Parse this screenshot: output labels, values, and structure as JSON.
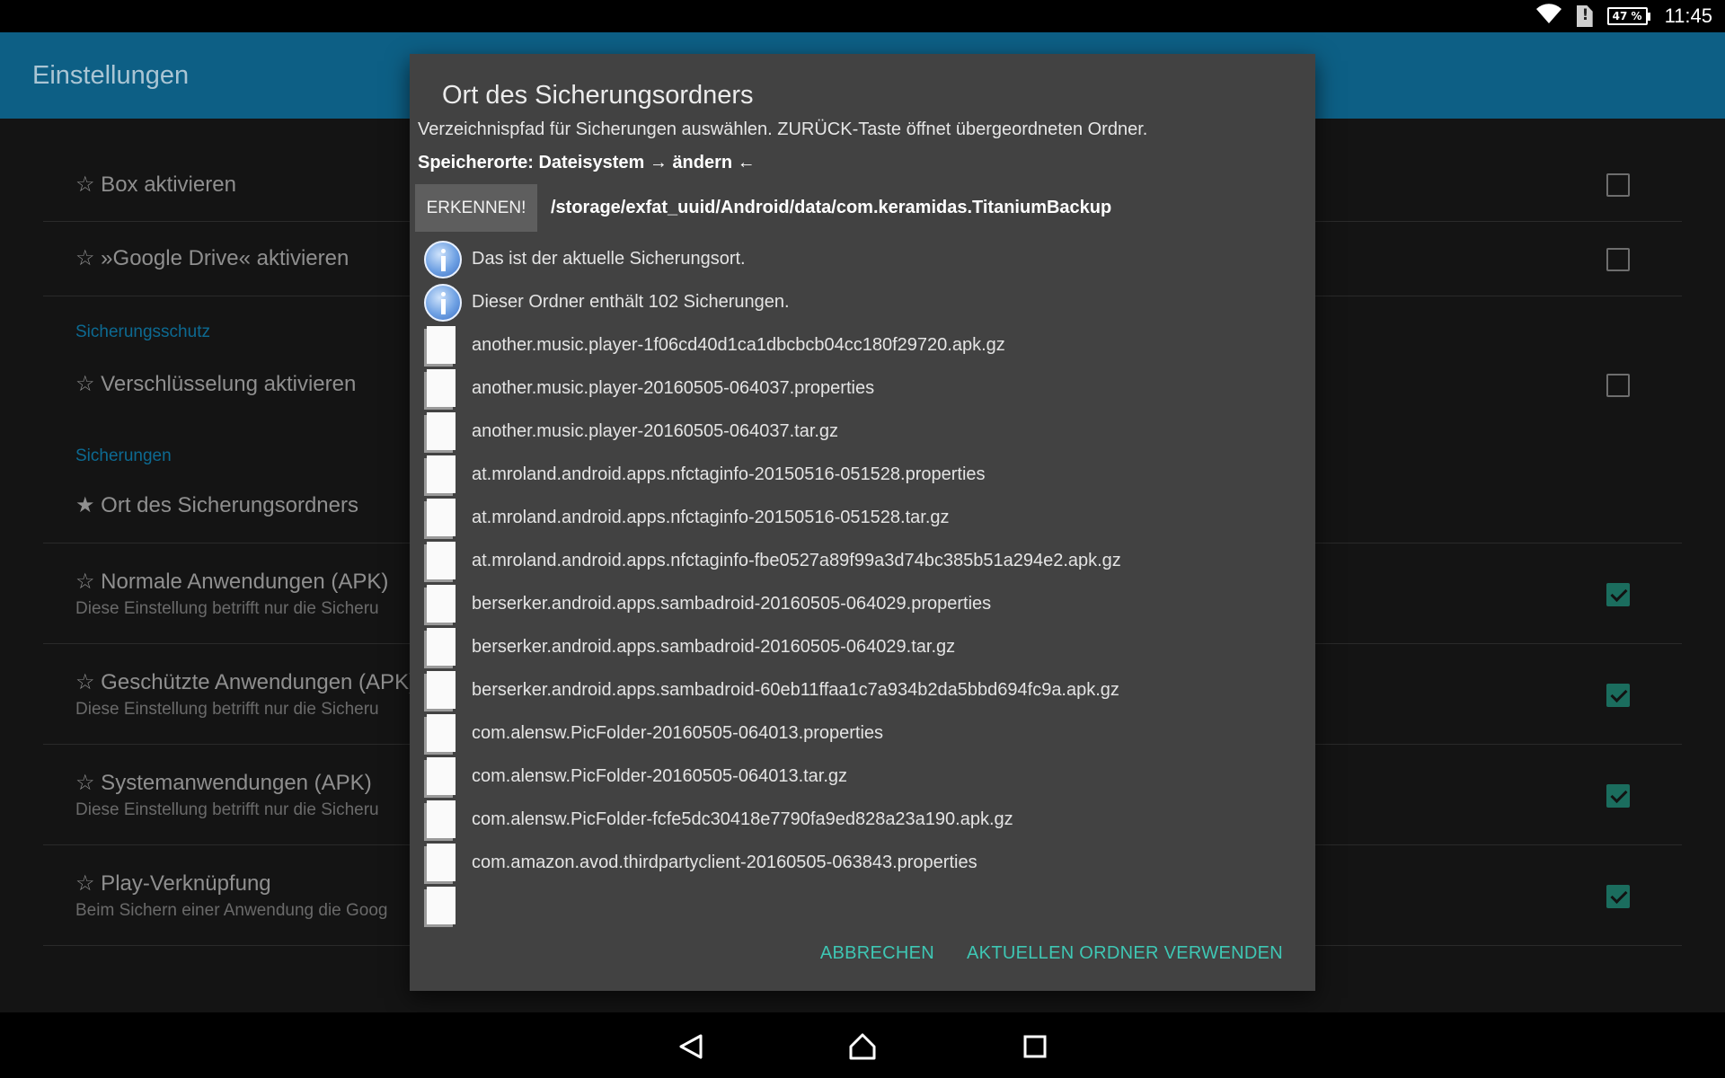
{
  "status_bar": {
    "battery": "47 %",
    "time": "11:45",
    "icons": [
      "wifi-icon",
      "sim-alert-icon",
      "battery-icon"
    ]
  },
  "app_bar": {
    "title": "Einstellungen"
  },
  "settings": {
    "items": [
      {
        "title": "☆ Box aktivieren",
        "checked": false
      },
      {
        "title": "☆ »Google Drive« aktivieren",
        "checked": false
      },
      {
        "title": "☆ Verschlüsselung aktivieren",
        "checked": false
      },
      {
        "title": "★ Ort des Sicherungsordners"
      },
      {
        "title": "☆ Normale Anwendungen (APK)",
        "subtitle": "Diese Einstellung betrifft nur die Sicheru",
        "checked": true
      },
      {
        "title": "☆ Geschützte Anwendungen (APK)",
        "subtitle": "Diese Einstellung betrifft nur die Sicheru",
        "checked": true
      },
      {
        "title": "☆ Systemanwendungen (APK)",
        "subtitle": "Diese Einstellung betrifft nur die Sicheru",
        "checked": true
      },
      {
        "title": "☆ Play-Verknüpfung",
        "subtitle": "Beim Sichern einer Anwendung die Goog",
        "checked": true
      }
    ],
    "headers": [
      "Sicherungsschutz",
      "Sicherungen"
    ]
  },
  "dialog": {
    "title": "Ort des Sicherungsordners",
    "description": "Verzeichnispfad für Sicherungen auswählen. ZURÜCK-Taste öffnet übergeordneten Ordner.",
    "storage_line": "Speicherorte: Dateisystem → ändern ←",
    "detect_label": "ERKENNEN!",
    "path": "/storage/exfat_uuid/Android/data/com.keramidas.TitaniumBackup",
    "entries": [
      {
        "icon": "info-icon",
        "label": "Das ist der aktuelle Sicherungsort."
      },
      {
        "icon": "info-icon",
        "label": "Dieser Ordner enthält 102 Sicherungen."
      },
      {
        "icon": "file-icon",
        "label": "another.music.player-1f06cd40d1ca1dbcbcb04cc180f29720.apk.gz"
      },
      {
        "icon": "file-icon",
        "label": "another.music.player-20160505-064037.properties"
      },
      {
        "icon": "file-icon",
        "label": "another.music.player-20160505-064037.tar.gz"
      },
      {
        "icon": "file-icon",
        "label": "at.mroland.android.apps.nfctaginfo-20150516-051528.properties"
      },
      {
        "icon": "file-icon",
        "label": "at.mroland.android.apps.nfctaginfo-20150516-051528.tar.gz"
      },
      {
        "icon": "file-icon",
        "label": "at.mroland.android.apps.nfctaginfo-fbe0527a89f99a3d74bc385b51a294e2.apk.gz"
      },
      {
        "icon": "file-icon",
        "label": "berserker.android.apps.sambadroid-20160505-064029.properties"
      },
      {
        "icon": "file-icon",
        "label": "berserker.android.apps.sambadroid-20160505-064029.tar.gz"
      },
      {
        "icon": "file-icon",
        "label": "berserker.android.apps.sambadroid-60eb11ffaa1c7a934b2da5bbd694fc9a.apk.gz"
      },
      {
        "icon": "file-icon",
        "label": "com.alensw.PicFolder-20160505-064013.properties"
      },
      {
        "icon": "file-icon",
        "label": "com.alensw.PicFolder-20160505-064013.tar.gz"
      },
      {
        "icon": "file-icon",
        "label": "com.alensw.PicFolder-fcfe5dc30418e7790fa9ed828a23a190.apk.gz"
      },
      {
        "icon": "file-icon",
        "label": "com.amazon.avod.thirdpartyclient-20160505-063843.properties"
      },
      {
        "icon": "file-icon",
        "label": ""
      }
    ],
    "cancel_label": "ABBRECHEN",
    "use_label": "AKTUELLEN ORDNER VERWENDEN"
  },
  "colors": {
    "accent": "#3ec7b4",
    "app_bar": "#0d5f85",
    "dialog_bg": "#424242"
  }
}
